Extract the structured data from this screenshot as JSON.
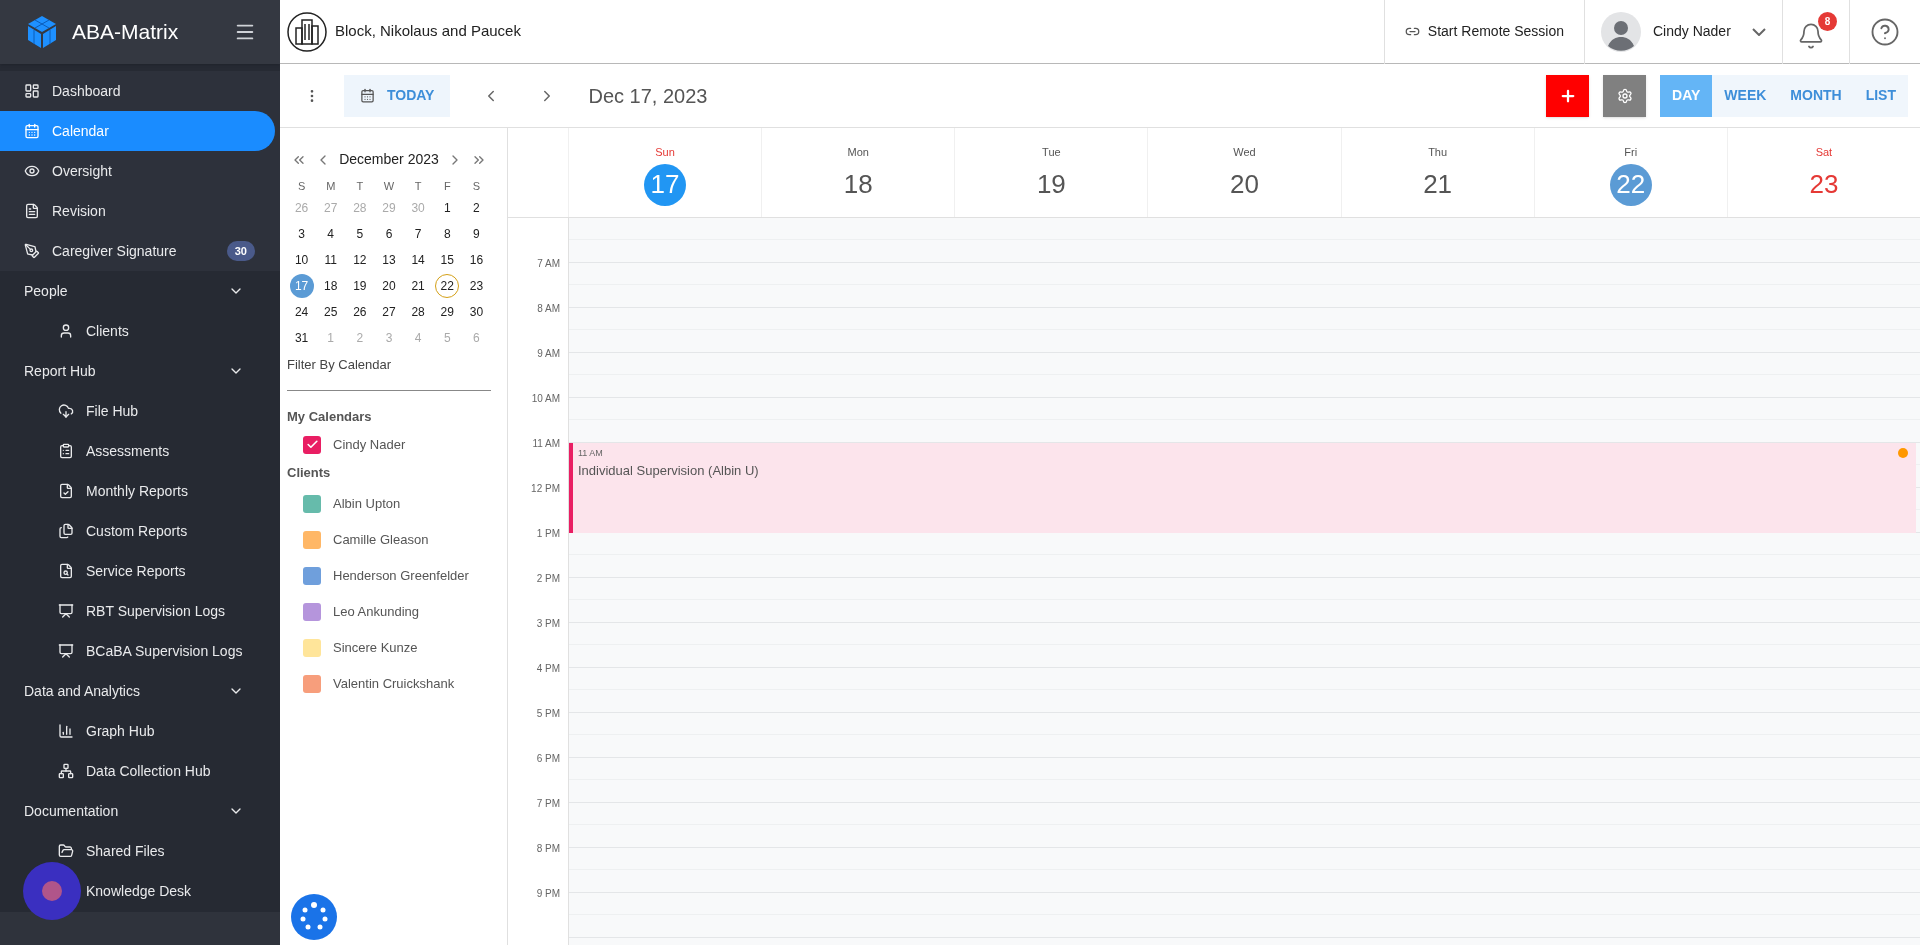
{
  "sidebar": {
    "brand": "ABA-Matrix",
    "items": [
      {
        "kind": "link",
        "label": "Dashboard",
        "selected": false
      },
      {
        "kind": "link",
        "label": "Calendar",
        "selected": true
      },
      {
        "kind": "link",
        "label": "Oversight",
        "selected": false
      },
      {
        "kind": "link",
        "label": "Revision",
        "selected": false
      },
      {
        "kind": "link",
        "label": "Caregiver Signature",
        "badge": "30",
        "selected": false
      },
      {
        "kind": "section",
        "label": "People",
        "expanded": true,
        "children": [
          {
            "label": "Clients",
            "selected": false
          }
        ]
      },
      {
        "kind": "section",
        "label": "Report Hub",
        "expanded": true,
        "children": [
          {
            "label": "File Hub",
            "selected": false
          },
          {
            "label": "Assessments",
            "selected": false
          },
          {
            "label": "Monthly Reports",
            "selected": false
          },
          {
            "label": "Custom Reports",
            "selected": false
          },
          {
            "label": "Service Reports",
            "selected": false
          },
          {
            "label": "RBT Supervision Logs",
            "selected": false
          },
          {
            "label": "BCaBA Supervision Logs",
            "selected": false
          }
        ]
      },
      {
        "kind": "section",
        "label": "Data and Analytics",
        "expanded": true,
        "children": [
          {
            "label": "Graph Hub",
            "selected": false
          },
          {
            "label": "Data Collection Hub",
            "selected": false
          }
        ]
      },
      {
        "kind": "section",
        "label": "Documentation",
        "expanded": true,
        "children": [
          {
            "label": "Shared Files",
            "selected": false
          },
          {
            "label": "Knowledge Desk",
            "selected": false
          }
        ]
      }
    ]
  },
  "header": {
    "organization": "Block, Nikolaus and Paucek",
    "remote_session": "Start Remote Session",
    "user": "Cindy Nader",
    "notification_count": "8"
  },
  "toolbar": {
    "today": "TODAY",
    "date": "Dec 17, 2023",
    "views": [
      {
        "label": "DAY",
        "selected": true
      },
      {
        "label": "WEEK",
        "selected": false
      },
      {
        "label": "MONTH",
        "selected": false
      },
      {
        "label": "LIST",
        "selected": false
      }
    ]
  },
  "mini_calendar": {
    "month": "December 2023",
    "weekdays": [
      "S",
      "M",
      "T",
      "W",
      "T",
      "F",
      "S"
    ],
    "weeks": [
      [
        {
          "label": "26",
          "muted": true,
          "selected": false,
          "today": false
        },
        {
          "label": "27",
          "muted": true,
          "selected": false,
          "today": false
        },
        {
          "label": "28",
          "muted": true,
          "selected": false,
          "today": false
        },
        {
          "label": "29",
          "muted": true,
          "selected": false,
          "today": false
        },
        {
          "label": "30",
          "muted": true,
          "selected": false,
          "today": false
        },
        {
          "label": "1",
          "muted": false,
          "selected": false,
          "today": false
        },
        {
          "label": "2",
          "muted": false,
          "selected": false,
          "today": false
        }
      ],
      [
        {
          "label": "3",
          "muted": false,
          "selected": false,
          "today": false
        },
        {
          "label": "4",
          "muted": false,
          "selected": false,
          "today": false
        },
        {
          "label": "5",
          "muted": false,
          "selected": false,
          "today": false
        },
        {
          "label": "6",
          "muted": false,
          "selected": false,
          "today": false
        },
        {
          "label": "7",
          "muted": false,
          "selected": false,
          "today": false
        },
        {
          "label": "8",
          "muted": false,
          "selected": false,
          "today": false
        },
        {
          "label": "9",
          "muted": false,
          "selected": false,
          "today": false
        }
      ],
      [
        {
          "label": "10",
          "muted": false,
          "selected": false,
          "today": false
        },
        {
          "label": "11",
          "muted": false,
          "selected": false,
          "today": false
        },
        {
          "label": "12",
          "muted": false,
          "selected": false,
          "today": false
        },
        {
          "label": "13",
          "muted": false,
          "selected": false,
          "today": false
        },
        {
          "label": "14",
          "muted": false,
          "selected": false,
          "today": false
        },
        {
          "label": "15",
          "muted": false,
          "selected": false,
          "today": false
        },
        {
          "label": "16",
          "muted": false,
          "selected": false,
          "today": false
        }
      ],
      [
        {
          "label": "17",
          "muted": false,
          "selected": true,
          "today": false
        },
        {
          "label": "18",
          "muted": false,
          "selected": false,
          "today": false
        },
        {
          "label": "19",
          "muted": false,
          "selected": false,
          "today": false
        },
        {
          "label": "20",
          "muted": false,
          "selected": false,
          "today": false
        },
        {
          "label": "21",
          "muted": false,
          "selected": false,
          "today": false
        },
        {
          "label": "22",
          "muted": false,
          "selected": false,
          "today": true
        },
        {
          "label": "23",
          "muted": false,
          "selected": false,
          "today": false
        }
      ],
      [
        {
          "label": "24",
          "muted": false,
          "selected": false,
          "today": false
        },
        {
          "label": "25",
          "muted": false,
          "selected": false,
          "today": false
        },
        {
          "label": "26",
          "muted": false,
          "selected": false,
          "today": false
        },
        {
          "label": "27",
          "muted": false,
          "selected": false,
          "today": false
        },
        {
          "label": "28",
          "muted": false,
          "selected": false,
          "today": false
        },
        {
          "label": "29",
          "muted": false,
          "selected": false,
          "today": false
        },
        {
          "label": "30",
          "muted": false,
          "selected": false,
          "today": false
        }
      ],
      [
        {
          "label": "31",
          "muted": false,
          "selected": false,
          "today": false
        },
        {
          "label": "1",
          "muted": true,
          "selected": false,
          "today": false
        },
        {
          "label": "2",
          "muted": true,
          "selected": false,
          "today": false
        },
        {
          "label": "3",
          "muted": true,
          "selected": false,
          "today": false
        },
        {
          "label": "4",
          "muted": true,
          "selected": false,
          "today": false
        },
        {
          "label": "5",
          "muted": true,
          "selected": false,
          "today": false
        },
        {
          "label": "6",
          "muted": true,
          "selected": false,
          "today": false
        }
      ]
    ]
  },
  "filters": {
    "title": "Filter By Calendar",
    "my_calendars_heading": "My Calendars",
    "my_calendars": [
      {
        "label": "Cindy Nader",
        "checked": true,
        "color": "#e91e63"
      }
    ],
    "clients_heading": "Clients",
    "clients": [
      {
        "label": "Albin Upton",
        "checked": false,
        "color": "#66bbab"
      },
      {
        "label": "Camille Gleason",
        "checked": false,
        "color": "#ffb766"
      },
      {
        "label": "Henderson Greenfelder",
        "checked": false,
        "color": "#6f9fdc"
      },
      {
        "label": "Leo Ankunding",
        "checked": false,
        "color": "#b595dc"
      },
      {
        "label": "Sincere Kunze",
        "checked": false,
        "color": "#ffe59a"
      },
      {
        "label": "Valentin Cruickshank",
        "checked": false,
        "color": "#f79e7c"
      }
    ]
  },
  "week": {
    "days": [
      {
        "name": "Sun",
        "date": "17",
        "weekend": true,
        "selected": true,
        "today": false
      },
      {
        "name": "Mon",
        "date": "18",
        "weekend": false,
        "selected": false,
        "today": false
      },
      {
        "name": "Tue",
        "date": "19",
        "weekend": false,
        "selected": false,
        "today": false
      },
      {
        "name": "Wed",
        "date": "20",
        "weekend": false,
        "selected": false,
        "today": false
      },
      {
        "name": "Thu",
        "date": "21",
        "weekend": false,
        "selected": false,
        "today": false
      },
      {
        "name": "Fri",
        "date": "22",
        "weekend": false,
        "selected": false,
        "today": true
      },
      {
        "name": "Sat",
        "date": "23",
        "weekend": true,
        "selected": false,
        "today": false
      }
    ],
    "time_labels": [
      "7 AM",
      "8 AM",
      "9 AM",
      "10 AM",
      "11 AM",
      "12 PM",
      "1 PM",
      "2 PM",
      "3 PM",
      "4 PM",
      "5 PM",
      "6 PM",
      "7 PM",
      "8 PM",
      "9 PM"
    ],
    "events": [
      {
        "time": "11 AM",
        "title": "Individual Supervision (Albin U)",
        "color": "#e91e63",
        "status_dot": {
          "color": "#ff9800"
        }
      }
    ]
  }
}
